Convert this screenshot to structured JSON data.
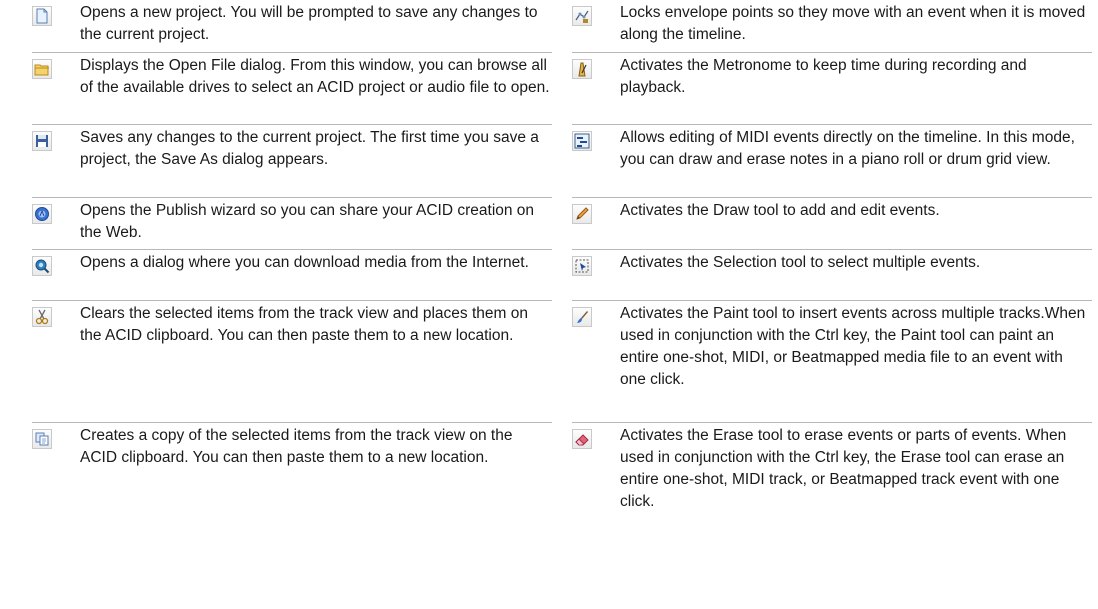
{
  "left": [
    {
      "icon": "new-document-icon",
      "text": "Opens a new project. You will be prompted to save any changes to the current project."
    },
    {
      "icon": "open-folder-icon",
      "text": "Displays the Open File dialog. From this window, you can browse all of the available drives to select an ACID project or audio file to open."
    },
    {
      "icon": "save-disk-icon",
      "text": "Saves any changes to the current project. The first time you save a project, the Save As dialog appears."
    },
    {
      "icon": "publish-globe-icon",
      "text": "Opens the Publish wizard so you can share your ACID creation on the Web."
    },
    {
      "icon": "download-media-icon",
      "text": "Opens a dialog where you can download media from the Internet."
    },
    {
      "icon": "cut-scissors-icon",
      "text": "Clears the selected items from the track view and places them on the ACID clipboard. You can then paste them to a new location."
    },
    {
      "icon": "copy-icon",
      "text": "Creates a copy of the selected items from the track view on the ACID clipboard. You can then paste them to a new location."
    }
  ],
  "right": [
    {
      "icon": "lock-envelopes-icon",
      "text": "Locks envelope points so they move with an event when it is moved along the timeline."
    },
    {
      "icon": "metronome-icon",
      "text": "Activates the Metronome to keep time during recording and playback."
    },
    {
      "icon": "inline-midi-edit-icon",
      "text": "Allows editing of MIDI events directly on the timeline. In this mode, you can draw and erase notes in a piano roll or drum grid view."
    },
    {
      "icon": "draw-pencil-icon",
      "text": "Activates the Draw tool to add and edit events."
    },
    {
      "icon": "selection-tool-icon",
      "text": "Activates the Selection tool to select multiple events."
    },
    {
      "icon": "paint-brush-icon",
      "text": "Activates the Paint tool to insert events across multiple tracks.When used in conjunction with the Ctrl key, the Paint tool can paint an entire one-shot, MIDI, or Beatmapped media file to an event with one click."
    },
    {
      "icon": "eraser-icon",
      "text": "Activates the Erase tool to erase events or parts of events. When used in conjunction with the Ctrl key, the Erase tool can erase an entire one-shot, MIDI track, or Beatmapped track event with one click."
    }
  ]
}
